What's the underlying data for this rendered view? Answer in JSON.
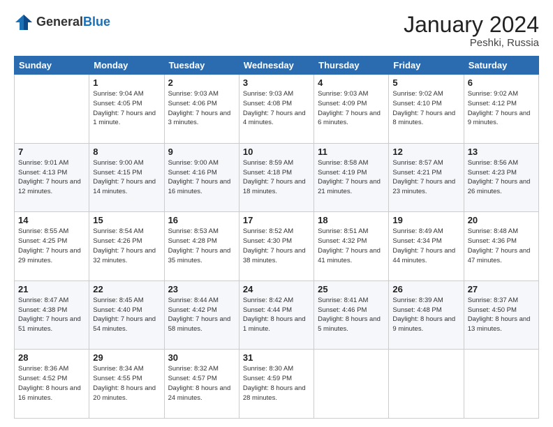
{
  "header": {
    "logo_line1": "General",
    "logo_line2": "Blue",
    "month_title": "January 2024",
    "subtitle": "Peshki, Russia"
  },
  "columns": [
    "Sunday",
    "Monday",
    "Tuesday",
    "Wednesday",
    "Thursday",
    "Friday",
    "Saturday"
  ],
  "rows": [
    [
      {
        "day": "",
        "sunrise": "",
        "sunset": "",
        "daylight": ""
      },
      {
        "day": "1",
        "sunrise": "Sunrise: 9:04 AM",
        "sunset": "Sunset: 4:05 PM",
        "daylight": "Daylight: 7 hours and 1 minute."
      },
      {
        "day": "2",
        "sunrise": "Sunrise: 9:03 AM",
        "sunset": "Sunset: 4:06 PM",
        "daylight": "Daylight: 7 hours and 3 minutes."
      },
      {
        "day": "3",
        "sunrise": "Sunrise: 9:03 AM",
        "sunset": "Sunset: 4:08 PM",
        "daylight": "Daylight: 7 hours and 4 minutes."
      },
      {
        "day": "4",
        "sunrise": "Sunrise: 9:03 AM",
        "sunset": "Sunset: 4:09 PM",
        "daylight": "Daylight: 7 hours and 6 minutes."
      },
      {
        "day": "5",
        "sunrise": "Sunrise: 9:02 AM",
        "sunset": "Sunset: 4:10 PM",
        "daylight": "Daylight: 7 hours and 8 minutes."
      },
      {
        "day": "6",
        "sunrise": "Sunrise: 9:02 AM",
        "sunset": "Sunset: 4:12 PM",
        "daylight": "Daylight: 7 hours and 9 minutes."
      }
    ],
    [
      {
        "day": "7",
        "sunrise": "Sunrise: 9:01 AM",
        "sunset": "Sunset: 4:13 PM",
        "daylight": "Daylight: 7 hours and 12 minutes."
      },
      {
        "day": "8",
        "sunrise": "Sunrise: 9:00 AM",
        "sunset": "Sunset: 4:15 PM",
        "daylight": "Daylight: 7 hours and 14 minutes."
      },
      {
        "day": "9",
        "sunrise": "Sunrise: 9:00 AM",
        "sunset": "Sunset: 4:16 PM",
        "daylight": "Daylight: 7 hours and 16 minutes."
      },
      {
        "day": "10",
        "sunrise": "Sunrise: 8:59 AM",
        "sunset": "Sunset: 4:18 PM",
        "daylight": "Daylight: 7 hours and 18 minutes."
      },
      {
        "day": "11",
        "sunrise": "Sunrise: 8:58 AM",
        "sunset": "Sunset: 4:19 PM",
        "daylight": "Daylight: 7 hours and 21 minutes."
      },
      {
        "day": "12",
        "sunrise": "Sunrise: 8:57 AM",
        "sunset": "Sunset: 4:21 PM",
        "daylight": "Daylight: 7 hours and 23 minutes."
      },
      {
        "day": "13",
        "sunrise": "Sunrise: 8:56 AM",
        "sunset": "Sunset: 4:23 PM",
        "daylight": "Daylight: 7 hours and 26 minutes."
      }
    ],
    [
      {
        "day": "14",
        "sunrise": "Sunrise: 8:55 AM",
        "sunset": "Sunset: 4:25 PM",
        "daylight": "Daylight: 7 hours and 29 minutes."
      },
      {
        "day": "15",
        "sunrise": "Sunrise: 8:54 AM",
        "sunset": "Sunset: 4:26 PM",
        "daylight": "Daylight: 7 hours and 32 minutes."
      },
      {
        "day": "16",
        "sunrise": "Sunrise: 8:53 AM",
        "sunset": "Sunset: 4:28 PM",
        "daylight": "Daylight: 7 hours and 35 minutes."
      },
      {
        "day": "17",
        "sunrise": "Sunrise: 8:52 AM",
        "sunset": "Sunset: 4:30 PM",
        "daylight": "Daylight: 7 hours and 38 minutes."
      },
      {
        "day": "18",
        "sunrise": "Sunrise: 8:51 AM",
        "sunset": "Sunset: 4:32 PM",
        "daylight": "Daylight: 7 hours and 41 minutes."
      },
      {
        "day": "19",
        "sunrise": "Sunrise: 8:49 AM",
        "sunset": "Sunset: 4:34 PM",
        "daylight": "Daylight: 7 hours and 44 minutes."
      },
      {
        "day": "20",
        "sunrise": "Sunrise: 8:48 AM",
        "sunset": "Sunset: 4:36 PM",
        "daylight": "Daylight: 7 hours and 47 minutes."
      }
    ],
    [
      {
        "day": "21",
        "sunrise": "Sunrise: 8:47 AM",
        "sunset": "Sunset: 4:38 PM",
        "daylight": "Daylight: 7 hours and 51 minutes."
      },
      {
        "day": "22",
        "sunrise": "Sunrise: 8:45 AM",
        "sunset": "Sunset: 4:40 PM",
        "daylight": "Daylight: 7 hours and 54 minutes."
      },
      {
        "day": "23",
        "sunrise": "Sunrise: 8:44 AM",
        "sunset": "Sunset: 4:42 PM",
        "daylight": "Daylight: 7 hours and 58 minutes."
      },
      {
        "day": "24",
        "sunrise": "Sunrise: 8:42 AM",
        "sunset": "Sunset: 4:44 PM",
        "daylight": "Daylight: 8 hours and 1 minute."
      },
      {
        "day": "25",
        "sunrise": "Sunrise: 8:41 AM",
        "sunset": "Sunset: 4:46 PM",
        "daylight": "Daylight: 8 hours and 5 minutes."
      },
      {
        "day": "26",
        "sunrise": "Sunrise: 8:39 AM",
        "sunset": "Sunset: 4:48 PM",
        "daylight": "Daylight: 8 hours and 9 minutes."
      },
      {
        "day": "27",
        "sunrise": "Sunrise: 8:37 AM",
        "sunset": "Sunset: 4:50 PM",
        "daylight": "Daylight: 8 hours and 13 minutes."
      }
    ],
    [
      {
        "day": "28",
        "sunrise": "Sunrise: 8:36 AM",
        "sunset": "Sunset: 4:52 PM",
        "daylight": "Daylight: 8 hours and 16 minutes."
      },
      {
        "day": "29",
        "sunrise": "Sunrise: 8:34 AM",
        "sunset": "Sunset: 4:55 PM",
        "daylight": "Daylight: 8 hours and 20 minutes."
      },
      {
        "day": "30",
        "sunrise": "Sunrise: 8:32 AM",
        "sunset": "Sunset: 4:57 PM",
        "daylight": "Daylight: 8 hours and 24 minutes."
      },
      {
        "day": "31",
        "sunrise": "Sunrise: 8:30 AM",
        "sunset": "Sunset: 4:59 PM",
        "daylight": "Daylight: 8 hours and 28 minutes."
      },
      {
        "day": "",
        "sunrise": "",
        "sunset": "",
        "daylight": ""
      },
      {
        "day": "",
        "sunrise": "",
        "sunset": "",
        "daylight": ""
      },
      {
        "day": "",
        "sunrise": "",
        "sunset": "",
        "daylight": ""
      }
    ]
  ]
}
